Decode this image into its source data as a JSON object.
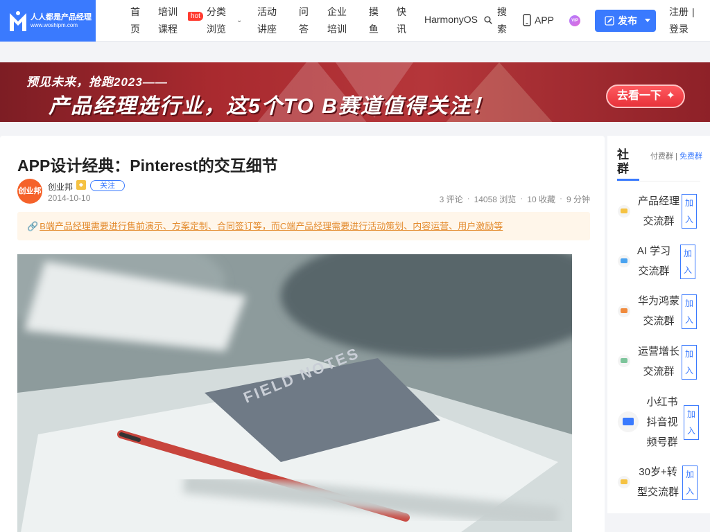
{
  "header": {
    "logo": {
      "name": "人人都是产品经理",
      "url_text": "www.woshipm.com"
    },
    "nav": [
      {
        "label": "首页"
      },
      {
        "label": "培训课程"
      },
      {
        "label": "分类浏览",
        "badge": "hot"
      },
      {
        "label": "活动讲座"
      },
      {
        "label": "问答"
      },
      {
        "label": "企业培训"
      },
      {
        "label": "摸鱼"
      },
      {
        "label": "快讯"
      }
    ],
    "harmony": "HarmonyOS",
    "search_label": "搜索",
    "app_label": "APP",
    "vip_label": "VIP",
    "publish_label": "发布",
    "register_label": "注册",
    "login_label": "登录",
    "auth_sep": "|"
  },
  "banner": {
    "line1": "预见未来，抢跑2023——",
    "line2": "产品经理选行业，这5个TO B赛道值得关注！",
    "button": "去看一下"
  },
  "article": {
    "title": "APP设计经典：Pinterest的交互细节",
    "author": "创业邦",
    "avatar_text": "创业邦",
    "follow_label": "关注",
    "date": "2014-10-10",
    "comments": "3 评论",
    "views": "14058 浏览",
    "favorites": "10 收藏",
    "read_time": "9 分钟",
    "meta_sep": "·",
    "tip_text": "B端产品经理需要进行售前演示、方案定制、合同签订等，而C端产品经理需要进行活动策划、内容运营、用户激励等",
    "photo_text": "FIELD NOTES"
  },
  "sidebar": {
    "heading": "社群",
    "tab_paid": "付费群",
    "tab_sep": "|",
    "tab_free": "免费群",
    "groups": [
      {
        "name": "产品经理交流群",
        "join": "加入",
        "color": "#f5c242"
      },
      {
        "name": "AI 学习交流群",
        "join": "加入",
        "color": "#4aa3f0"
      },
      {
        "name": "华为鸿蒙交流群",
        "join": "加入",
        "color": "#f08a3c"
      },
      {
        "name": "运营增长交流群",
        "join": "加入",
        "color": "#7cc49a"
      },
      {
        "name": "小红书抖音视频号群",
        "join": "加入",
        "color": "#3a7afe"
      },
      {
        "name": "30岁+转型交流群",
        "join": "加入",
        "color": "#f5c242"
      }
    ]
  }
}
